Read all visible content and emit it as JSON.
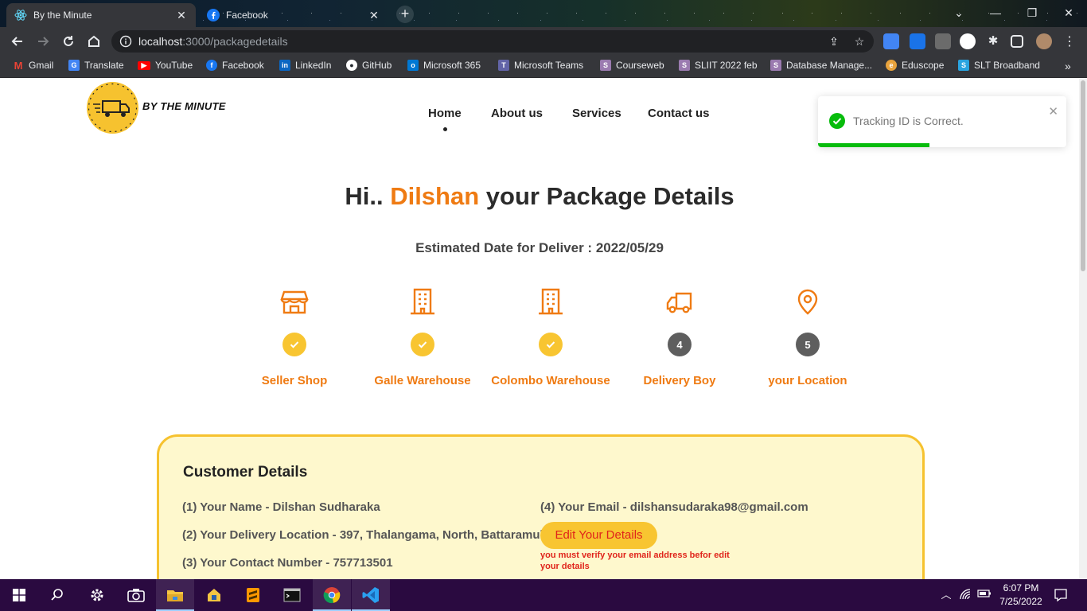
{
  "browser": {
    "tabs": [
      {
        "title": "By the Minute",
        "active": true,
        "icon": "react-icon"
      },
      {
        "title": "Facebook",
        "active": false,
        "icon": "facebook-icon"
      }
    ],
    "url_host": "localhost",
    "url_path": ":3000/packagedetails",
    "bookmarks": [
      {
        "label": "Gmail",
        "icon": "gmail-icon",
        "color": "#ea4335"
      },
      {
        "label": "Translate",
        "icon": "translate-icon",
        "color": "#4285f4"
      },
      {
        "label": "YouTube",
        "icon": "youtube-icon",
        "color": "#ff0000"
      },
      {
        "label": "Facebook",
        "icon": "facebook-icon",
        "color": "#1877f2"
      },
      {
        "label": "LinkedIn",
        "icon": "linkedin-icon",
        "color": "#0a66c2"
      },
      {
        "label": "GitHub",
        "icon": "github-icon",
        "color": "#ffffff"
      },
      {
        "label": "Microsoft 365",
        "icon": "outlook-icon",
        "color": "#0078d4"
      },
      {
        "label": "Microsoft Teams",
        "icon": "teams-icon",
        "color": "#6264a7"
      },
      {
        "label": "Courseweb",
        "icon": "sliit-icon",
        "color": "#9b7bb0"
      },
      {
        "label": "SLIIT 2022 feb",
        "icon": "sliit-icon",
        "color": "#9b7bb0"
      },
      {
        "label": "Database Manage...",
        "icon": "sliit-icon",
        "color": "#9b7bb0"
      },
      {
        "label": "Eduscope",
        "icon": "eduscope-icon",
        "color": "#e8a33d"
      },
      {
        "label": "SLT Broadband",
        "icon": "slt-icon",
        "color": "#2aa4e0"
      }
    ]
  },
  "site": {
    "brand": "BY THE MINUTE",
    "nav": [
      "Home",
      "About us",
      "Services",
      "Contact us"
    ],
    "toast": "Tracking ID is Correct.",
    "toast_progress": 0.45,
    "heading_pre": "Hi..",
    "heading_name": "Dilshan",
    "heading_post": "your Package Details",
    "eta": "Estimated Date for Deliver : 2022/05/29",
    "steps": [
      {
        "label": "Seller Shop",
        "status": "done",
        "marker": "",
        "icon": "store-icon"
      },
      {
        "label": "Galle Warehouse",
        "status": "done",
        "marker": "",
        "icon": "building-icon"
      },
      {
        "label": "Colombo Warehouse",
        "status": "done",
        "marker": "",
        "icon": "building-icon"
      },
      {
        "label": "Delivery Boy",
        "status": "pending",
        "marker": "4",
        "icon": "truck-icon"
      },
      {
        "label": "your Location",
        "status": "pending",
        "marker": "5",
        "icon": "location-pin-icon"
      }
    ],
    "customer": {
      "title": "Customer Details",
      "name": "(1) Your Name - Dilshan Sudharaka",
      "location": "(2) Your Delivery Location - 397, Thalangama, North, Battaramulla",
      "contact": "(3) Your Contact Number - 757713501",
      "email": "(4) Your Email - dilshansudaraka98@gmail.com",
      "edit_button": "Edit Your Details",
      "warning": "you must verify your email address befor edit your details"
    }
  },
  "taskbar": {
    "time": "6:07 PM",
    "date": "7/25/2022"
  },
  "colors": {
    "accent": "#ef7b13",
    "yellow": "#f8c531",
    "card_bg": "#fef8cd",
    "error": "#e0241b",
    "toast_success": "#07bc0c"
  }
}
